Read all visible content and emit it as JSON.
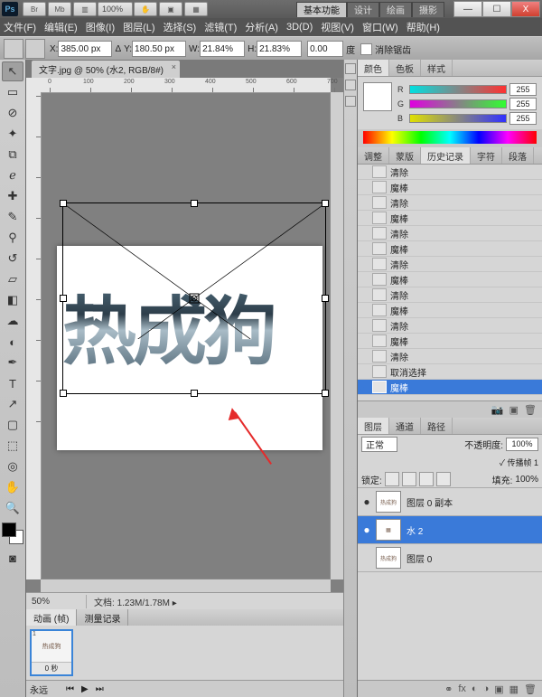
{
  "title_bar": {
    "ps": "Ps"
  },
  "workspace_tabs": [
    "基本功能",
    "设计",
    "绘画",
    "摄影"
  ],
  "window_controls": {
    "min": "—",
    "max": "☐",
    "close": "X"
  },
  "menus": [
    "文件(F)",
    "编辑(E)",
    "图像(I)",
    "图层(L)",
    "选择(S)",
    "滤镜(T)",
    "分析(A)",
    "3D(D)",
    "视图(V)",
    "窗口(W)",
    "帮助(H)"
  ],
  "options": {
    "x_lbl": "X:",
    "x_val": "385.00 px",
    "y_lbl": "Y:",
    "y_val": "180.50 px",
    "w_lbl": "W:",
    "w_val": "21.84%",
    "h_lbl": "H:",
    "h_val": "21.83%",
    "ang_val": "0.00",
    "ang_lbl": "度",
    "check": "消除锯齿",
    "delta": "Δ",
    "zoom_top": "100%"
  },
  "doc_tab": "文字.jpg @ 50% (水2, RGB/8#)",
  "rulers_h": [
    "0",
    "100",
    "200",
    "300",
    "400",
    "500",
    "600",
    "700"
  ],
  "rulers_v": [
    "0",
    "100",
    "200",
    "300",
    "400",
    "500",
    "600",
    "700",
    "800"
  ],
  "big_text": "热成狗",
  "status": {
    "zoom": "50%",
    "doc_lbl": "文档:",
    "doc_val": "1.23M/1.78M"
  },
  "anim_tabs": [
    "动画 (帧)",
    "测量记录"
  ],
  "frame": {
    "num": "1",
    "thumb": "热成狗",
    "time": "0 秒"
  },
  "footer": {
    "mode": "永远",
    "play": "▶"
  },
  "color_tabs": [
    "颜色",
    "色板",
    "样式"
  ],
  "rgb": {
    "r": "R",
    "g": "G",
    "b": "B",
    "rv": "255",
    "gv": "255",
    "bv": "255"
  },
  "hist_tabs": [
    "调整",
    "蒙版",
    "历史记录",
    "字符",
    "段落"
  ],
  "history": [
    {
      "t": "清除"
    },
    {
      "t": "魔棒"
    },
    {
      "t": "清除"
    },
    {
      "t": "魔棒"
    },
    {
      "t": "清除"
    },
    {
      "t": "魔棒"
    },
    {
      "t": "清除"
    },
    {
      "t": "魔棒"
    },
    {
      "t": "清除"
    },
    {
      "t": "魔棒"
    },
    {
      "t": "清除"
    },
    {
      "t": "魔棒"
    },
    {
      "t": "清除"
    },
    {
      "t": "取消选择"
    },
    {
      "t": "魔棒",
      "sel": true
    }
  ],
  "layer_tabs": [
    "图层",
    "通道",
    "路径"
  ],
  "layer_opts": {
    "blend": "正常",
    "op_lbl": "不透明度:",
    "op_val": "100%",
    "fill_lbl": "填充:",
    "fill_val": "100%",
    "lock": "锁定:",
    "prop": "✓ 传播帧 1"
  },
  "layers": [
    {
      "eye": "●",
      "name": "图层 0 副本",
      "thumb": "热成狗"
    },
    {
      "eye": "●",
      "name": "水 2",
      "thumb": "▦",
      "sel": true
    },
    {
      "eye": "",
      "name": "图层 0",
      "thumb": "热成狗"
    }
  ]
}
